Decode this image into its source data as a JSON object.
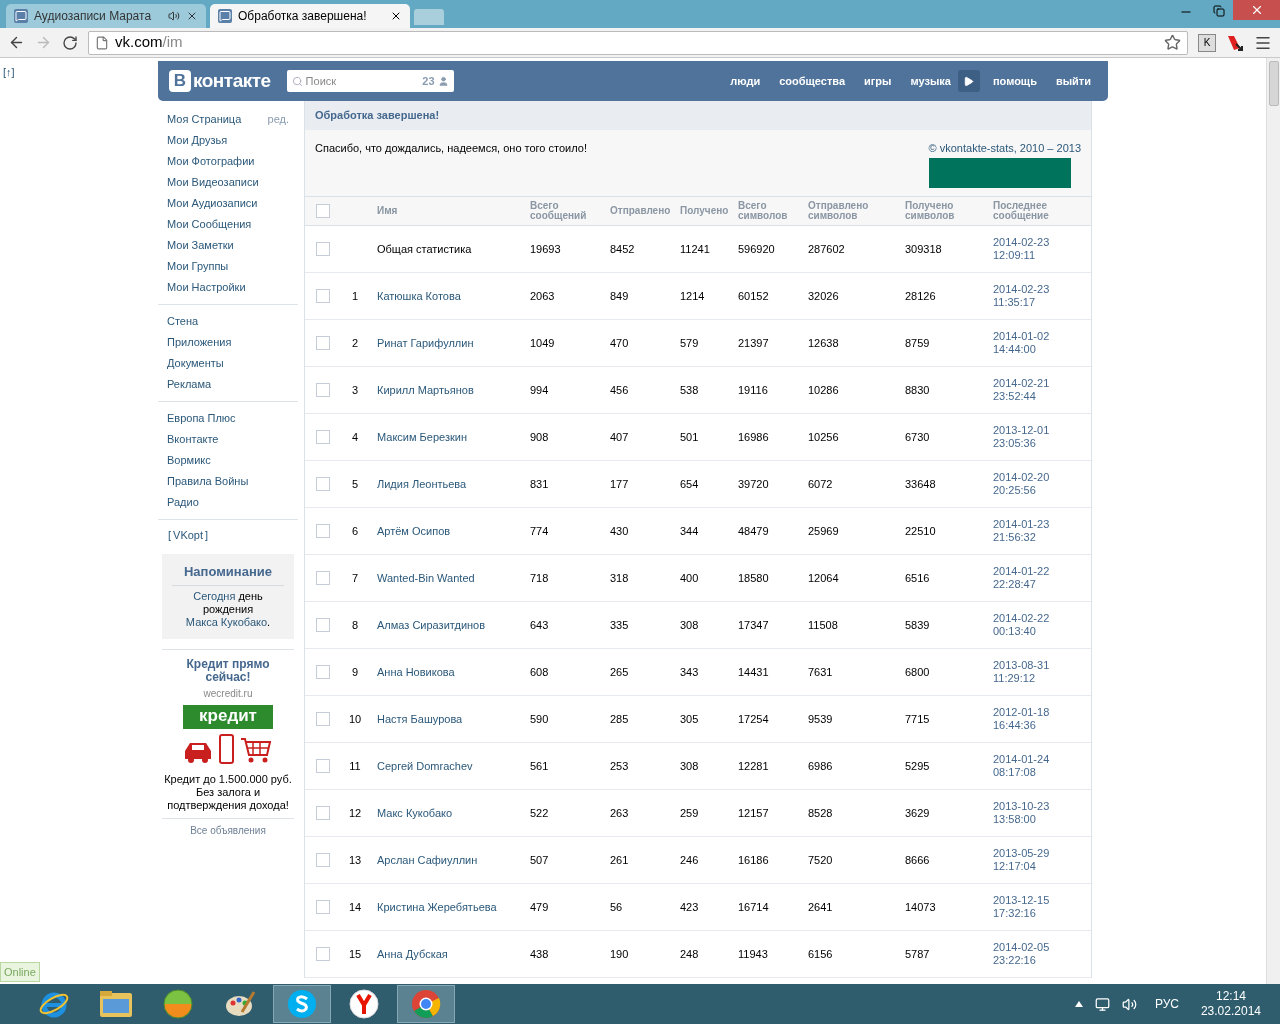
{
  "browser": {
    "tabs": [
      {
        "title": "Аудиозаписи Марата",
        "selected": false,
        "audio": true
      },
      {
        "title": "Обработка завершена!",
        "selected": true,
        "audio": false
      }
    ],
    "url_host": "vk.com",
    "url_path": "/im",
    "extension_key": "K"
  },
  "scroll_up": "[↑]",
  "header": {
    "logo_letter": "В",
    "logo_text": "контакте",
    "search": {
      "placeholder": "Поиск",
      "count": "23"
    },
    "nav": [
      {
        "kind": "link",
        "label": "люди"
      },
      {
        "kind": "link",
        "label": "сообщества"
      },
      {
        "kind": "link",
        "label": "игры"
      },
      {
        "kind": "link",
        "label": "музыка"
      },
      {
        "kind": "play"
      },
      {
        "kind": "link",
        "label": "помощь"
      },
      {
        "kind": "link",
        "label": "выйти"
      }
    ]
  },
  "sidebar": {
    "sections": [
      [
        {
          "label": "Моя Страница",
          "action": "ред."
        },
        {
          "label": "Мои Друзья"
        },
        {
          "label": "Мои Фотографии"
        },
        {
          "label": "Мои Видеозаписи"
        },
        {
          "label": "Мои Аудиозаписи"
        },
        {
          "label": "Мои Сообщения"
        },
        {
          "label": "Мои Заметки"
        },
        {
          "label": "Мои Группы"
        },
        {
          "label": "Мои Настройки"
        }
      ],
      [
        {
          "label": "Стена"
        },
        {
          "label": "Приложения"
        },
        {
          "label": "Документы"
        },
        {
          "label": "Реклама"
        }
      ],
      [
        {
          "label": "Европа Плюс"
        },
        {
          "label": "Вконтакте"
        },
        {
          "label": "Вормикс"
        },
        {
          "label": "Правила Войны"
        },
        {
          "label": "Радио"
        }
      ]
    ],
    "vkopt": {
      "before": "[",
      "label": "VKopt",
      "after": "]"
    },
    "reminder": {
      "title": "Напоминание",
      "parts": [
        {
          "kind": "link",
          "text": "Сегодня"
        },
        {
          "kind": "text",
          "text": " день рождения "
        },
        {
          "kind": "link",
          "text": "Макса Кукобако"
        },
        {
          "kind": "text",
          "text": "."
        }
      ]
    },
    "ad": {
      "title": "Кредит прямо сейчас!",
      "domain": "wecredit.ru",
      "banner": "кредит",
      "text": "Кредит до 1.500.000 руб. Без залога и подтверждения дохода!",
      "all_ads": "Все объявления"
    }
  },
  "content": {
    "title": "Обработка завершена!",
    "message": "Спасибо, что дождались, надеемся, оно того стоило!",
    "copyright": "© vkontakte-stats, 2010 – 2013",
    "select_all_checked": false,
    "columns": [
      "Имя",
      "Всего сообщений",
      "Отправлено",
      "Получено",
      "Всего символов",
      "Отправлено символов",
      "Получено символов",
      "Последнее сообщение"
    ],
    "rows": [
      {
        "kind": "total",
        "checked": false,
        "name": "Общая статистика",
        "values": [
          "19693",
          "8452",
          "11241",
          "596920",
          "287602",
          "309318"
        ],
        "date": "2014-02-23",
        "time": "12:09:11"
      },
      {
        "kind": "contact",
        "checked": false,
        "number": "1",
        "name": "Катюшка Котова",
        "values": [
          "2063",
          "849",
          "1214",
          "60152",
          "32026",
          "28126"
        ],
        "date": "2014-02-23",
        "time": "11:35:17"
      },
      {
        "kind": "contact",
        "checked": false,
        "number": "2",
        "name": "Ринат Гарифуллин",
        "values": [
          "1049",
          "470",
          "579",
          "21397",
          "12638",
          "8759"
        ],
        "date": "2014-01-02",
        "time": "14:44:00"
      },
      {
        "kind": "contact",
        "checked": false,
        "number": "3",
        "name": "Кирилл Мартьянов",
        "values": [
          "994",
          "456",
          "538",
          "19116",
          "10286",
          "8830"
        ],
        "date": "2014-02-21",
        "time": "23:52:44"
      },
      {
        "kind": "contact",
        "checked": false,
        "number": "4",
        "name": "Максим Березкин",
        "values": [
          "908",
          "407",
          "501",
          "16986",
          "10256",
          "6730"
        ],
        "date": "2013-12-01",
        "time": "23:05:36"
      },
      {
        "kind": "contact",
        "checked": false,
        "number": "5",
        "name": "Лидия Леонтьева",
        "values": [
          "831",
          "177",
          "654",
          "39720",
          "6072",
          "33648"
        ],
        "date": "2014-02-20",
        "time": "20:25:56"
      },
      {
        "kind": "contact",
        "checked": false,
        "number": "6",
        "name": "Артём Осипов",
        "values": [
          "774",
          "430",
          "344",
          "48479",
          "25969",
          "22510"
        ],
        "date": "2014-01-23",
        "time": "21:56:32"
      },
      {
        "kind": "contact",
        "checked": false,
        "number": "7",
        "name": "Wanted-Bin Wanted",
        "values": [
          "718",
          "318",
          "400",
          "18580",
          "12064",
          "6516"
        ],
        "date": "2014-01-22",
        "time": "22:28:47"
      },
      {
        "kind": "contact",
        "checked": false,
        "number": "8",
        "name": "Алмаз Сиразитдинов",
        "values": [
          "643",
          "335",
          "308",
          "17347",
          "11508",
          "5839"
        ],
        "date": "2014-02-22",
        "time": "00:13:40"
      },
      {
        "kind": "contact",
        "checked": false,
        "number": "9",
        "name": "Анна Новикова",
        "values": [
          "608",
          "265",
          "343",
          "14431",
          "7631",
          "6800"
        ],
        "date": "2013-08-31",
        "time": "11:29:12"
      },
      {
        "kind": "contact",
        "checked": false,
        "number": "10",
        "name": "Настя Башурова",
        "values": [
          "590",
          "285",
          "305",
          "17254",
          "9539",
          "7715"
        ],
        "date": "2012-01-18",
        "time": "16:44:36"
      },
      {
        "kind": "contact",
        "checked": false,
        "number": "11",
        "name": "Сергей Domrachev",
        "values": [
          "561",
          "253",
          "308",
          "12281",
          "6986",
          "5295"
        ],
        "date": "2014-01-24",
        "time": "08:17:08"
      },
      {
        "kind": "contact",
        "checked": false,
        "number": "12",
        "name": "Макс Кукобако",
        "values": [
          "522",
          "263",
          "259",
          "12157",
          "8528",
          "3629"
        ],
        "date": "2013-10-23",
        "time": "13:58:00"
      },
      {
        "kind": "contact",
        "checked": false,
        "number": "13",
        "name": "Арслан Сафиуллин",
        "values": [
          "507",
          "261",
          "246",
          "16186",
          "7520",
          "8666"
        ],
        "date": "2013-05-29",
        "time": "12:17:04"
      },
      {
        "kind": "contact",
        "checked": false,
        "number": "14",
        "name": "Кристина Жеребятьева",
        "values": [
          "479",
          "56",
          "423",
          "16714",
          "2641",
          "14073"
        ],
        "date": "2013-12-15",
        "time": "17:32:16"
      },
      {
        "kind": "contact",
        "checked": false,
        "number": "15",
        "name": "Анна Дубская",
        "values": [
          "438",
          "190",
          "248",
          "11943",
          "6156",
          "5787"
        ],
        "date": "2014-02-05",
        "time": "23:22:16"
      }
    ]
  },
  "online": "Online",
  "taskbar": {
    "apps": [
      {
        "kind": "ie",
        "running": false
      },
      {
        "kind": "explorer",
        "running": false
      },
      {
        "kind": "ball",
        "running": false
      },
      {
        "kind": "paint",
        "running": false
      },
      {
        "kind": "skype",
        "running": true
      },
      {
        "kind": "yandex",
        "running": false
      },
      {
        "kind": "chrome",
        "running": true
      }
    ],
    "language": "РУС",
    "time": "12:14",
    "date": "23.02.2014"
  }
}
